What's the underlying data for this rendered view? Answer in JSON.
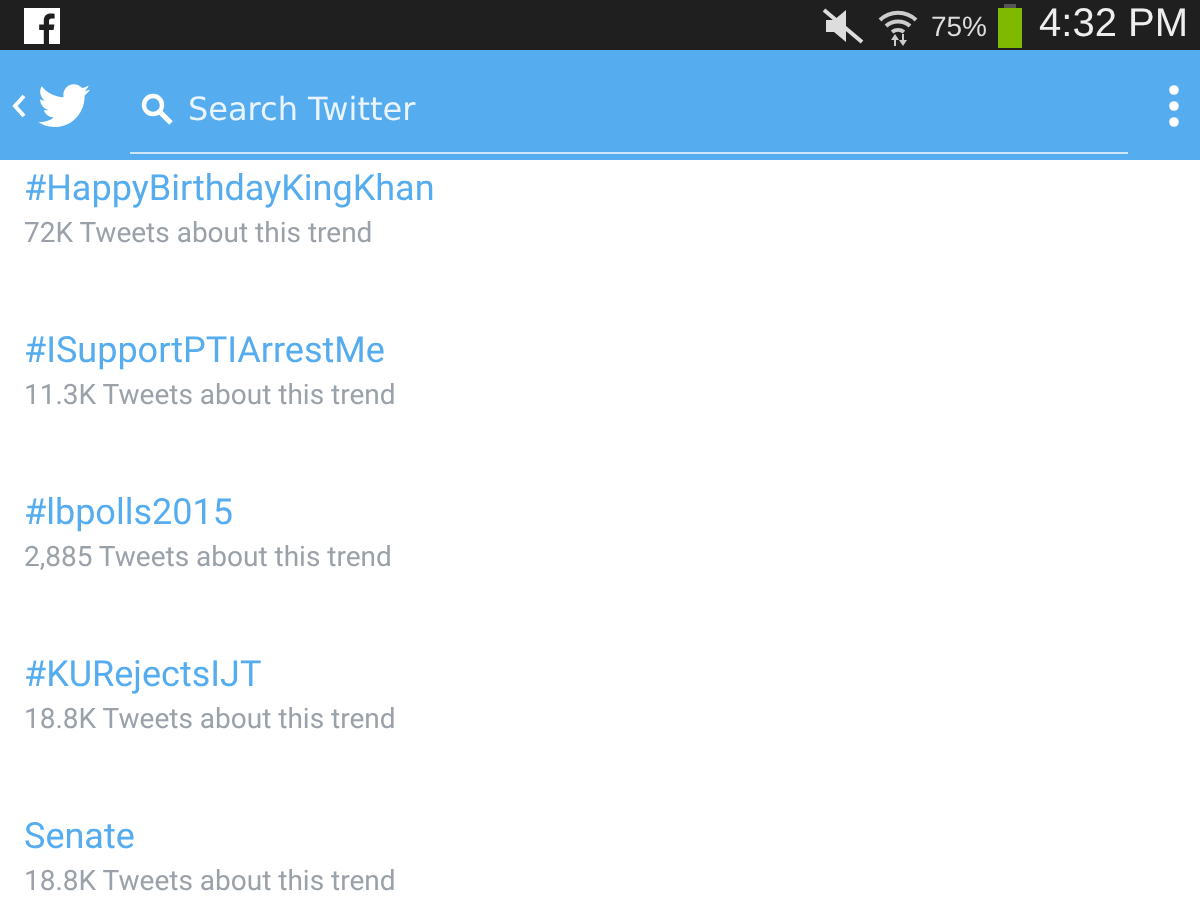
{
  "status_bar": {
    "battery_percent": "75%",
    "time": "4:32 PM"
  },
  "app_bar": {
    "search": {
      "placeholder": "Search Twitter"
    }
  },
  "trends": [
    {
      "name": "#HappyBirthdayKingKhan",
      "count": "72K Tweets about this trend"
    },
    {
      "name": "#ISupportPTIArrestMe",
      "count": "11.3K Tweets about this trend"
    },
    {
      "name": "#lbpolls2015",
      "count": "2,885 Tweets about this trend"
    },
    {
      "name": "#KURejectsIJT",
      "count": "18.8K Tweets about this trend"
    },
    {
      "name": "Senate",
      "count": "18.8K Tweets about this trend"
    }
  ]
}
